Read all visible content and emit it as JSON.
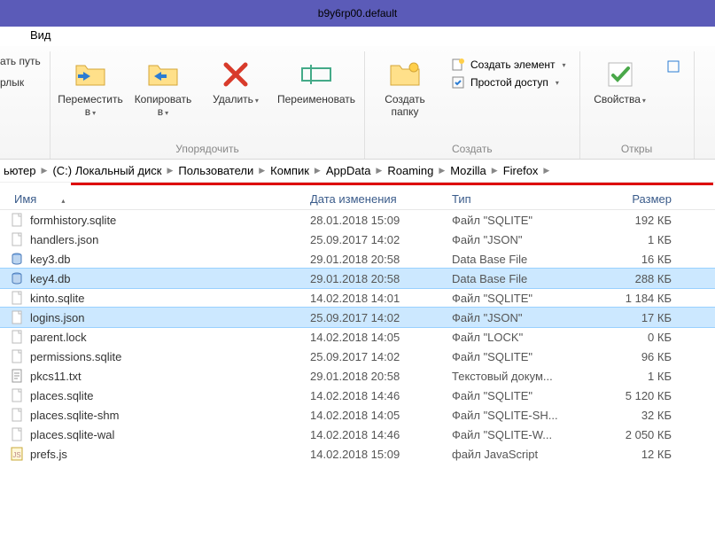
{
  "titlebar": {
    "title": "b9y6rp00.default"
  },
  "tabs": {
    "view": "Вид"
  },
  "ribbon": {
    "left": {
      "path": "ать путь",
      "shortcut": "рлык"
    },
    "organize": {
      "move": "Переместить в",
      "copy": "Копировать в",
      "delete": "Удалить",
      "rename": "Переименовать",
      "label": "Упорядочить"
    },
    "create": {
      "new_folder": "Создать папку",
      "new_item": "Создать элемент",
      "easy_access": "Простой доступ",
      "label": "Создать"
    },
    "open": {
      "properties": "Свойства",
      "label": "Откры"
    }
  },
  "breadcrumb": [
    "ьютер",
    "(C:) Локальный диск",
    "Пользователи",
    "Компик",
    "AppData",
    "Roaming",
    "Mozilla",
    "Firefox"
  ],
  "columns": {
    "name": "Имя",
    "date": "Дата изменения",
    "type": "Тип",
    "size": "Размер"
  },
  "files": [
    {
      "icon": "file",
      "name": "formhistory.sqlite",
      "date": "28.01.2018 15:09",
      "type": "Файл \"SQLITE\"",
      "size": "192 КБ",
      "selected": false
    },
    {
      "icon": "file",
      "name": "handlers.json",
      "date": "25.09.2017 14:02",
      "type": "Файл \"JSON\"",
      "size": "1 КБ",
      "selected": false
    },
    {
      "icon": "db",
      "name": "key3.db",
      "date": "29.01.2018 20:58",
      "type": "Data Base File",
      "size": "16 КБ",
      "selected": false
    },
    {
      "icon": "db",
      "name": "key4.db",
      "date": "29.01.2018 20:58",
      "type": "Data Base File",
      "size": "288 КБ",
      "selected": true
    },
    {
      "icon": "file",
      "name": "kinto.sqlite",
      "date": "14.02.2018 14:01",
      "type": "Файл \"SQLITE\"",
      "size": "1 184 КБ",
      "selected": false
    },
    {
      "icon": "file",
      "name": "logins.json",
      "date": "25.09.2017 14:02",
      "type": "Файл \"JSON\"",
      "size": "17 КБ",
      "selected": true
    },
    {
      "icon": "file",
      "name": "parent.lock",
      "date": "14.02.2018 14:05",
      "type": "Файл \"LOCK\"",
      "size": "0 КБ",
      "selected": false
    },
    {
      "icon": "file",
      "name": "permissions.sqlite",
      "date": "25.09.2017 14:02",
      "type": "Файл \"SQLITE\"",
      "size": "96 КБ",
      "selected": false
    },
    {
      "icon": "txt",
      "name": "pkcs11.txt",
      "date": "29.01.2018 20:58",
      "type": "Текстовый докум...",
      "size": "1 КБ",
      "selected": false
    },
    {
      "icon": "file",
      "name": "places.sqlite",
      "date": "14.02.2018 14:46",
      "type": "Файл \"SQLITE\"",
      "size": "5 120 КБ",
      "selected": false
    },
    {
      "icon": "file",
      "name": "places.sqlite-shm",
      "date": "14.02.2018 14:05",
      "type": "Файл \"SQLITE-SH...",
      "size": "32 КБ",
      "selected": false
    },
    {
      "icon": "file",
      "name": "places.sqlite-wal",
      "date": "14.02.2018 14:46",
      "type": "Файл \"SQLITE-W...",
      "size": "2 050 КБ",
      "selected": false
    },
    {
      "icon": "js",
      "name": "prefs.js",
      "date": "14.02.2018 15:09",
      "type": "файл JavaScript",
      "size": "12 КБ",
      "selected": false
    }
  ]
}
